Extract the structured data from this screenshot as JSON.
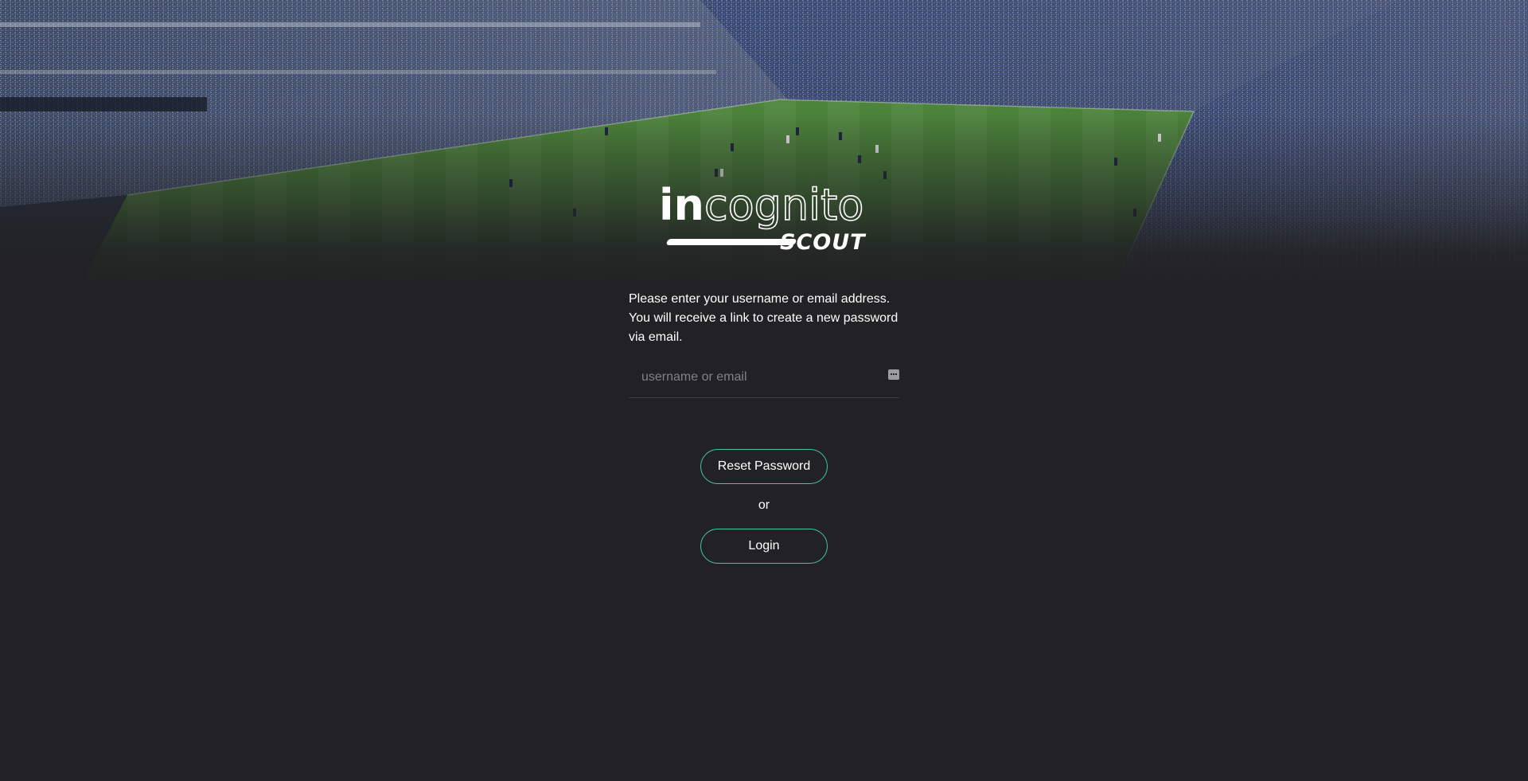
{
  "brand": {
    "wordmark_bold": "in",
    "wordmark_outline": "cognito",
    "subtitle": "SCOUT"
  },
  "form": {
    "instructions": "Please enter your username or email address. You will receive a link to create a new password via email.",
    "username_placeholder": "username or email",
    "username_value": "",
    "reset_label": "Reset Password",
    "or_label": "or",
    "login_label": "Login"
  },
  "colors": {
    "background": "#222224",
    "accent": "#3dc8a0",
    "text": "#ffffff",
    "placeholder": "#7f8287"
  },
  "icons": {
    "password_manager": "key-icon"
  }
}
